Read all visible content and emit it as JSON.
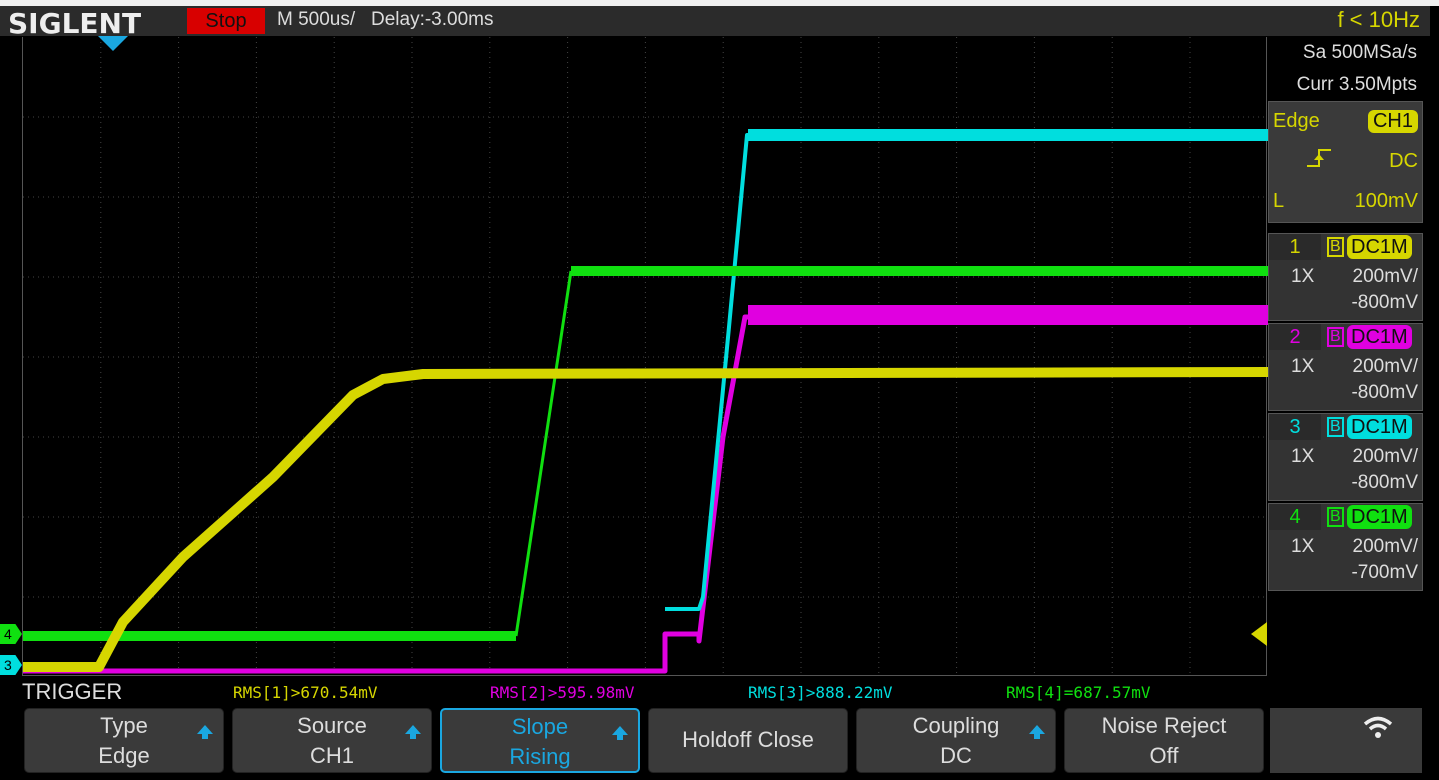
{
  "header": {
    "logo": "SIGLENT",
    "run_state": "Stop",
    "timebase": "M 500us/",
    "delay": "Delay:-3.00ms",
    "frequency": "f < 10Hz"
  },
  "acquisition": {
    "sample_rate": "Sa 500MSa/s",
    "memory": "Curr 3.50Mpts"
  },
  "trigger_info": {
    "type": "Edge",
    "source": "CH1",
    "coupling": "DC",
    "level_label": "L",
    "level": "100mV",
    "slope_icon": "rising-edge-icon"
  },
  "channels": [
    {
      "num": "1",
      "bw": "B",
      "coupling": "DC1M",
      "probe": "1X",
      "scale": "200mV/",
      "offset": "-800mV",
      "color": "#d6d600"
    },
    {
      "num": "2",
      "bw": "B",
      "coupling": "DC1M",
      "probe": "1X",
      "scale": "200mV/",
      "offset": "-800mV",
      "color": "#e000e0"
    },
    {
      "num": "3",
      "bw": "B",
      "coupling": "DC1M",
      "probe": "1X",
      "scale": "200mV/",
      "offset": "-800mV",
      "color": "#00dede"
    },
    {
      "num": "4",
      "bw": "B",
      "coupling": "DC1M",
      "probe": "1X",
      "scale": "200mV/",
      "offset": "-700mV",
      "color": "#10e010"
    }
  ],
  "markers": {
    "ch4": "4",
    "ch3": "3"
  },
  "menu_title": "TRIGGER",
  "measurements": [
    "RMS[1]>670.54mV",
    "RMS[2]>595.98mV",
    "RMS[3]>888.22mV",
    "RMS[4]=687.57mV"
  ],
  "menu": [
    {
      "line1": "Type",
      "line2": "Edge"
    },
    {
      "line1": "Source",
      "line2": "CH1"
    },
    {
      "line1": "Slope",
      "line2": "Rising"
    },
    {
      "line1": "Holdoff Close"
    },
    {
      "line1": "Coupling",
      "line2": "DC"
    },
    {
      "line1": "Noise Reject",
      "line2": "Off"
    }
  ]
}
